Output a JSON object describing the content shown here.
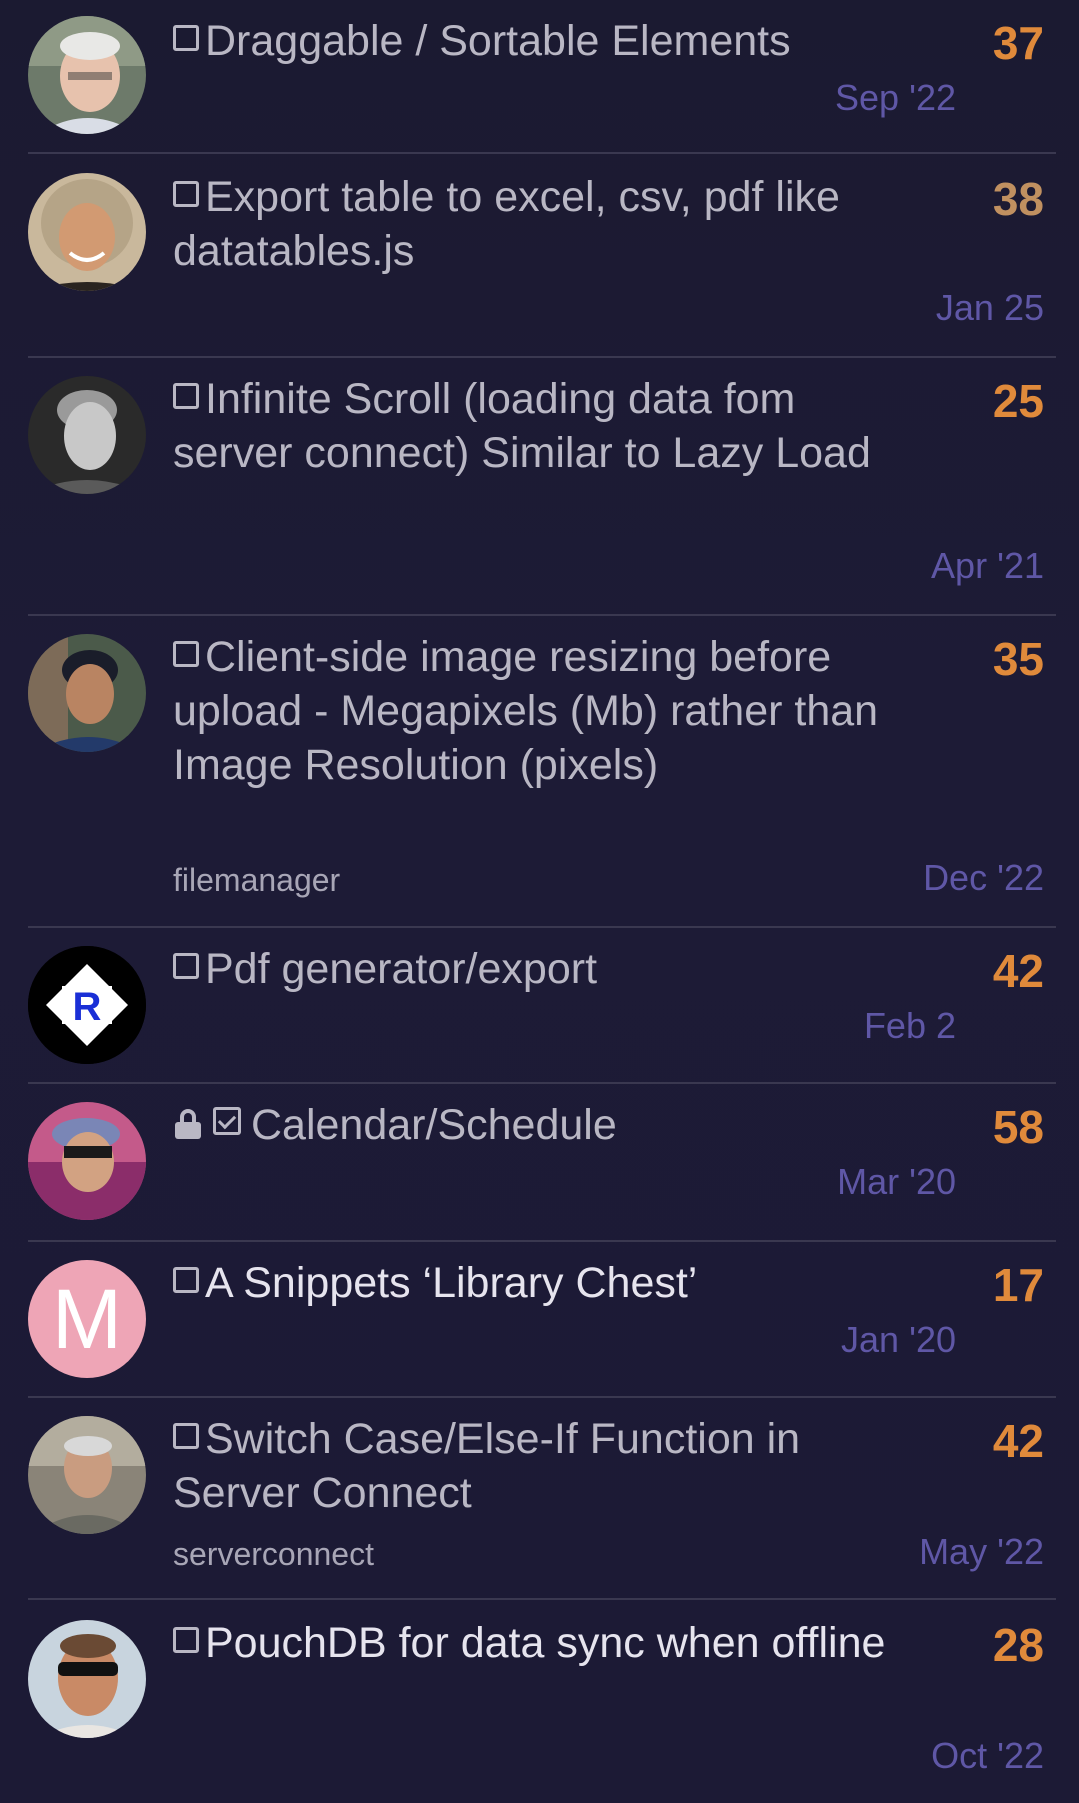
{
  "topics": [
    {
      "title": "Draggable / Sortable Elements",
      "count": "37",
      "date": "Sep '22",
      "tag": "",
      "avatar": "photo-elderly-man",
      "closed": false,
      "solved": false
    },
    {
      "title": "Export table to excel, csv, pdf like datatables.js",
      "count": "38",
      "date": "Jan 25",
      "tag": "",
      "avatar": "photo-curly-hair-man",
      "closed": false,
      "solved": false
    },
    {
      "title": "Infinite Scroll (loading data fom server connect) Similar to Lazy Load",
      "count": "25",
      "date": "Apr '21",
      "tag": "",
      "avatar": "photo-bw-man",
      "closed": false,
      "solved": false
    },
    {
      "title": "Client-side image resizing before upload - Megapixels (Mb) rather than Image Resolution (pixels)",
      "count": "35",
      "date": "Dec '22",
      "tag": "filemanager",
      "avatar": "photo-young-man",
      "closed": false,
      "solved": false
    },
    {
      "title": "Pdf generator/export",
      "count": "42",
      "date": "Feb 2",
      "tag": "",
      "avatar": "logo-r",
      "closed": false,
      "solved": false
    },
    {
      "title": "Calendar/Schedule",
      "count": "58",
      "date": "Mar '20",
      "tag": "",
      "avatar": "photo-man-cap",
      "closed": true,
      "solved": true
    },
    {
      "title": "A Snippets ‘Library Chest’",
      "count": "17",
      "date": "Jan '20",
      "tag": "",
      "avatar": "letter-avatar",
      "avatar_letter": "M",
      "closed": false,
      "solved": false
    },
    {
      "title": "Switch Case/Else-If Function in Server Connect",
      "count": "42",
      "date": "May '22",
      "tag": "serverconnect",
      "avatar": "photo-man-sweater",
      "closed": false,
      "solved": false
    },
    {
      "title": "PouchDB for data sync when offline",
      "count": "28",
      "date": "Oct '22",
      "tag": "",
      "avatar": "photo-man-sunglasses",
      "closed": false,
      "solved": false
    }
  ],
  "colors": {
    "background": "#1c1a35",
    "count": "#e08a3b",
    "date": "#5f57a6",
    "letter_avatar_bg": "#eea5b6"
  }
}
